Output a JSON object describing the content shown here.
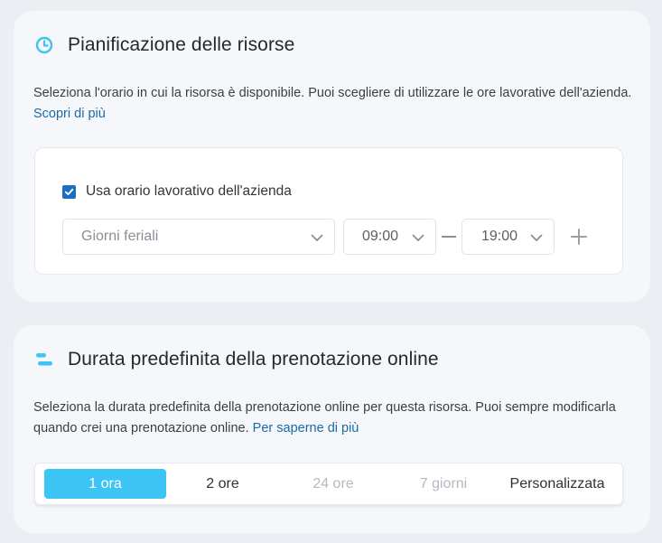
{
  "colors": {
    "accent": "#3cc5f4",
    "link": "#1a6aa8",
    "checkbox": "#1a6fc4"
  },
  "scheduling": {
    "icon": "clock-icon",
    "title": "Pianificazione delle risorse",
    "description": "Seleziona l'orario in cui la risorsa è disponibile. Puoi scegliere di utilizzare le ore lavorative dell'azienda.",
    "learn_more": "Scopri di più",
    "use_company_hours": {
      "label": "Usa orario lavorativo dell'azienda",
      "checked": true
    },
    "days_select": "Giorni feriali",
    "start_time": "09:00",
    "end_time": "19:00",
    "add_icon": "plus-icon"
  },
  "booking_duration": {
    "icon": "duration-bars-icon",
    "title": "Durata predefinita della prenotazione online",
    "description": "Seleziona la durata predefinita della prenotazione online per questa risorsa. Puoi sempre modificarla quando crei una prenotazione online.",
    "learn_more": "Per saperne di più",
    "options": [
      {
        "label": "1 ora",
        "state": "active"
      },
      {
        "label": "2 ore",
        "state": "normal"
      },
      {
        "label": "24 ore",
        "state": "disabled"
      },
      {
        "label": "7 giorni",
        "state": "disabled"
      },
      {
        "label": "Personalizzata",
        "state": "normal"
      }
    ]
  }
}
